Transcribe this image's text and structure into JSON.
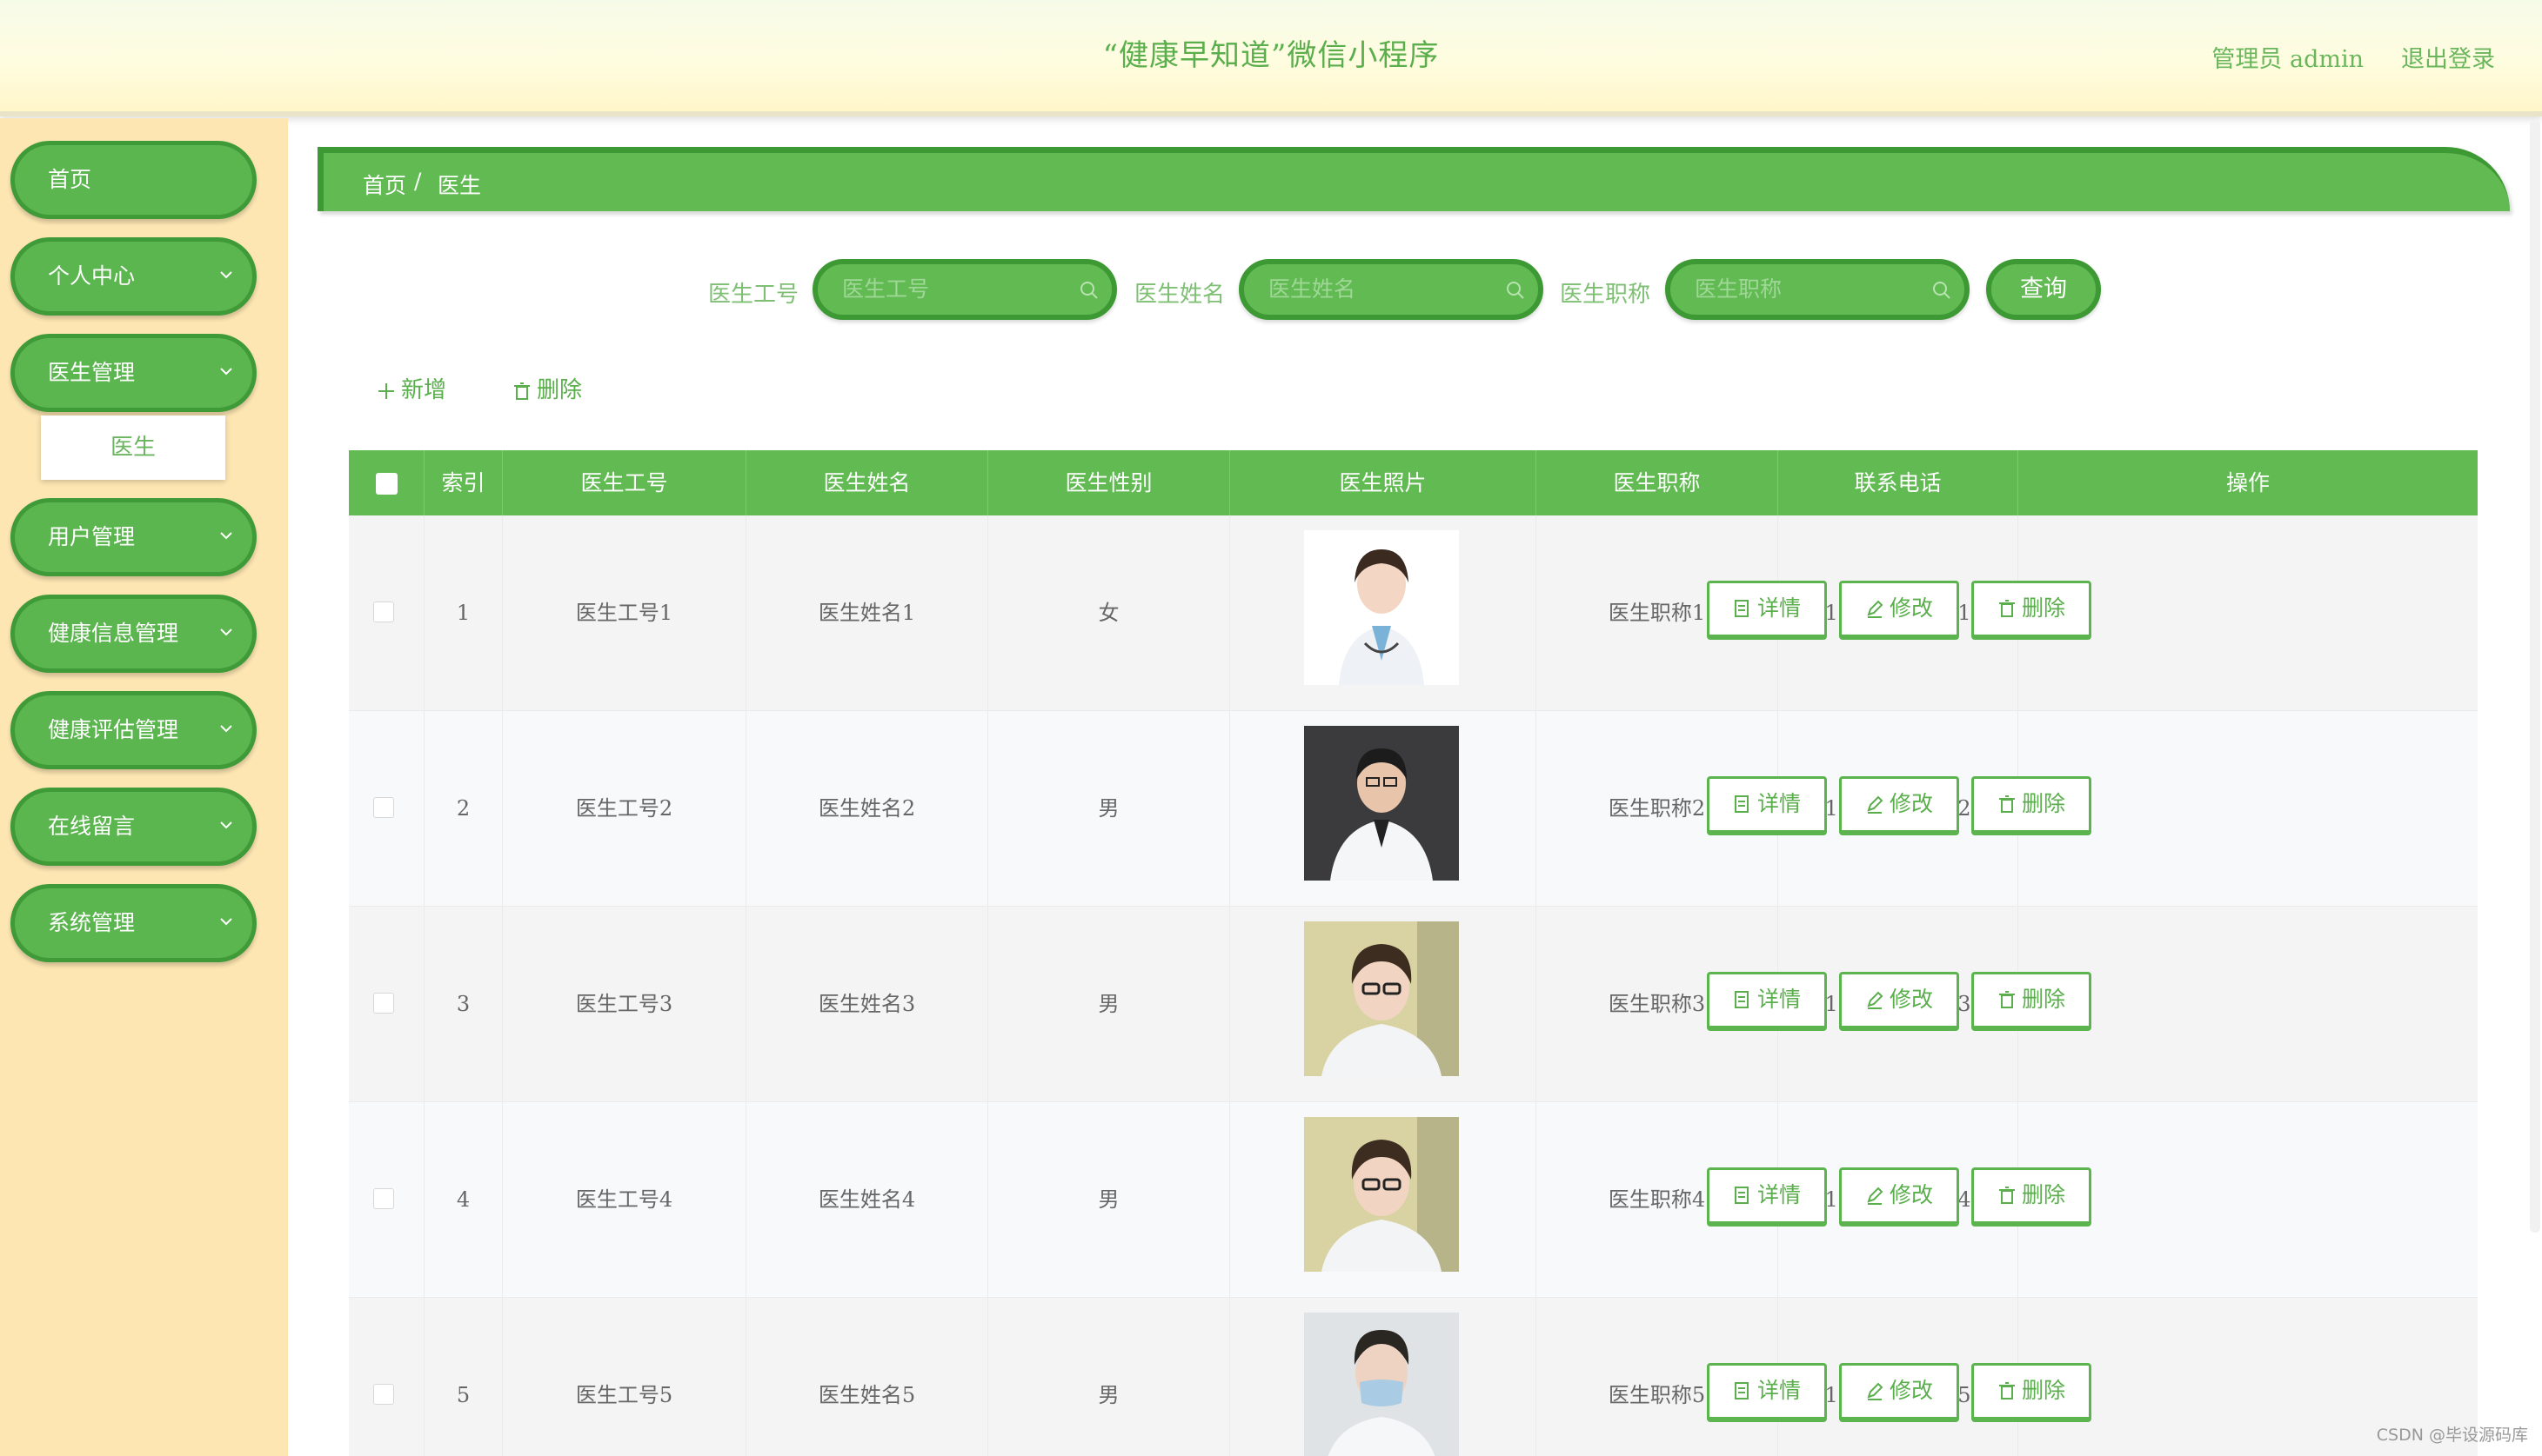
{
  "header": {
    "title": "“健康早知道”微信小程序",
    "user": "管理员 admin",
    "logout": "退出登录"
  },
  "sidebar": {
    "items": [
      {
        "label": "首页",
        "has_arrow": false
      },
      {
        "label": "个人中心",
        "has_arrow": true
      },
      {
        "label": "医生管理",
        "has_arrow": true
      },
      {
        "label": "用户管理",
        "has_arrow": true
      },
      {
        "label": "健康信息管理",
        "has_arrow": true
      },
      {
        "label": "健康评估管理",
        "has_arrow": true
      },
      {
        "label": "在线留言",
        "has_arrow": true
      },
      {
        "label": "系统管理",
        "has_arrow": true
      }
    ],
    "submenu_active": "医生"
  },
  "breadcrumb": {
    "home": "首页",
    "sep": "/",
    "current": "医生"
  },
  "search": {
    "fields": [
      {
        "label": "医生工号",
        "placeholder": "医生工号"
      },
      {
        "label": "医生姓名",
        "placeholder": "医生姓名"
      },
      {
        "label": "医生职称",
        "placeholder": "医生职称"
      }
    ],
    "button": "查询"
  },
  "actions": {
    "add": "新增",
    "delete": "删除"
  },
  "table": {
    "columns": [
      "索引",
      "医生工号",
      "医生姓名",
      "医生性别",
      "医生照片",
      "医生职称",
      "联系电话",
      "操作"
    ],
    "rows": [
      {
        "index": "1",
        "id": "医生工号1",
        "name": "医生姓名1",
        "gender": "女",
        "title": "医生职称1",
        "phone": "13823888881"
      },
      {
        "index": "2",
        "id": "医生工号2",
        "name": "医生姓名2",
        "gender": "男",
        "title": "医生职称2",
        "phone": "13823888882"
      },
      {
        "index": "3",
        "id": "医生工号3",
        "name": "医生姓名3",
        "gender": "男",
        "title": "医生职称3",
        "phone": "13823888883"
      },
      {
        "index": "4",
        "id": "医生工号4",
        "name": "医生姓名4",
        "gender": "男",
        "title": "医生职称4",
        "phone": "13823888884"
      },
      {
        "index": "5",
        "id": "医生工号5",
        "name": "医生姓名5",
        "gender": "男",
        "title": "医生职称5",
        "phone": "13823888885"
      }
    ],
    "row_buttons": {
      "detail": "详情",
      "edit": "修改",
      "delete": "删除"
    }
  },
  "watermark": "CSDN @毕设源码库",
  "colors": {
    "primary": "#62ba53",
    "primary_dark": "#3d9934",
    "sidebar_bg": "#fde6b2",
    "text_green": "#5aae4c"
  }
}
